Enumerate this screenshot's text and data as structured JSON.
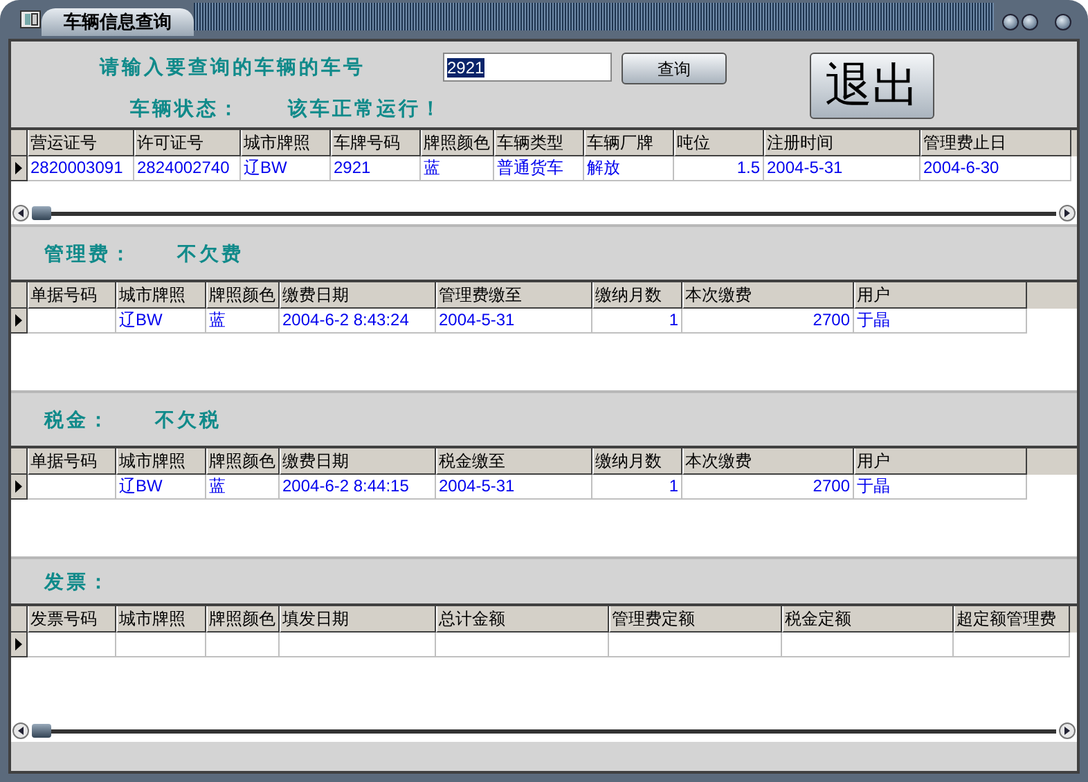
{
  "window": {
    "title": "车辆信息查询"
  },
  "query": {
    "prompt": "请输入要查询的车辆的车号",
    "value": "2921",
    "query_button": "查询",
    "exit_button": "退出",
    "status_label": "车辆状态：",
    "status_value": "该车正常运行！"
  },
  "grids": [
    {
      "scrollbar": true,
      "columns": [
        {
          "label": "营运证号",
          "kind": "text"
        },
        {
          "label": "许可证号",
          "kind": "text"
        },
        {
          "label": "城市牌照",
          "kind": "text"
        },
        {
          "label": "车牌号码",
          "kind": "text"
        },
        {
          "label": "牌照颜色",
          "kind": "text"
        },
        {
          "label": "车辆类型",
          "kind": "text"
        },
        {
          "label": "车辆厂牌",
          "kind": "text"
        },
        {
          "label": "吨位",
          "kind": "number"
        },
        {
          "label": "注册时间",
          "kind": "text"
        },
        {
          "label": "管理费止日",
          "kind": "text"
        }
      ],
      "rows": [
        {
          "current": true,
          "cells": [
            "2820003091",
            "2824002740",
            "辽BW",
            "2921",
            "蓝",
            "普通货车",
            "解放",
            "1.5",
            "2004-5-31",
            "2004-6-30"
          ]
        }
      ]
    }
  ],
  "sections": [
    {
      "heading": "管理费：",
      "value": "不欠费",
      "grid": {
        "scrollbar": false,
        "columns": [
          {
            "label": "单据号码",
            "kind": "text"
          },
          {
            "label": "城市牌照",
            "kind": "text"
          },
          {
            "label": "牌照颜色",
            "kind": "text"
          },
          {
            "label": "缴费日期",
            "kind": "text"
          },
          {
            "label": "管理费缴至",
            "kind": "text"
          },
          {
            "label": "缴纳月数",
            "kind": "number"
          },
          {
            "label": "本次缴费",
            "kind": "number"
          },
          {
            "label": "用户",
            "kind": "text"
          }
        ],
        "rows": [
          {
            "current": true,
            "cells": [
              "",
              "辽BW",
              "蓝",
              "2004-6-2 8:43:24",
              "2004-5-31",
              "1",
              "2700",
              "于晶"
            ]
          }
        ]
      }
    },
    {
      "heading": "税金：",
      "value": "不欠税",
      "grid": {
        "scrollbar": false,
        "columns": [
          {
            "label": "单据号码",
            "kind": "text"
          },
          {
            "label": "城市牌照",
            "kind": "text"
          },
          {
            "label": "牌照颜色",
            "kind": "text"
          },
          {
            "label": "缴费日期",
            "kind": "text"
          },
          {
            "label": "税金缴至",
            "kind": "text"
          },
          {
            "label": "缴纳月数",
            "kind": "number"
          },
          {
            "label": "本次缴费",
            "kind": "number"
          },
          {
            "label": "用户",
            "kind": "text"
          }
        ],
        "rows": [
          {
            "current": true,
            "cells": [
              "",
              "辽BW",
              "蓝",
              "2004-6-2 8:44:15",
              "2004-5-31",
              "1",
              "2700",
              "于晶"
            ]
          }
        ]
      }
    },
    {
      "heading": "发票：",
      "grid": {
        "scrollbar": true,
        "columns": [
          {
            "label": "发票号码",
            "kind": "text"
          },
          {
            "label": "城市牌照",
            "kind": "text"
          },
          {
            "label": "牌照颜色",
            "kind": "text"
          },
          {
            "label": "填发日期",
            "kind": "text"
          },
          {
            "label": "总计金额",
            "kind": "text"
          },
          {
            "label": "管理费定额",
            "kind": "text"
          },
          {
            "label": "税金定额",
            "kind": "text"
          },
          {
            "label": "超定额管理费",
            "kind": "text"
          }
        ],
        "rows": [
          {
            "current": true,
            "cells": [
              "",
              "",
              "",
              "",
              "",
              "",
              "",
              ""
            ]
          }
        ]
      }
    }
  ]
}
